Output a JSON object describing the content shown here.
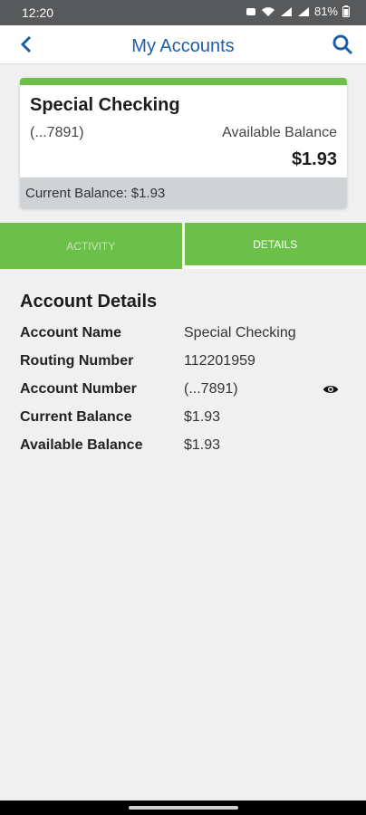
{
  "status_bar": {
    "time": "12:20",
    "battery": "81%"
  },
  "header": {
    "title": "My Accounts"
  },
  "account_card": {
    "name": "Special Checking",
    "masked_number": "(...7891)",
    "available_label": "Available Balance",
    "available_value": "$1.93",
    "current_balance_text": "Current Balance: $1.93"
  },
  "tabs": [
    {
      "label": "ACTIVITY",
      "active": false
    },
    {
      "label": "DETAILS",
      "active": true
    }
  ],
  "details": {
    "heading": "Account Details",
    "rows": [
      {
        "label": "Account Name",
        "value": "Special Checking"
      },
      {
        "label": "Routing Number",
        "value": "112201959"
      },
      {
        "label": "Account Number",
        "value": "(...7891)"
      },
      {
        "label": "Current Balance",
        "value": "$1.93"
      },
      {
        "label": "Available Balance",
        "value": "$1.93"
      }
    ]
  },
  "colors": {
    "brand_green": "#6cc04a",
    "brand_blue": "#1f5fa6"
  }
}
